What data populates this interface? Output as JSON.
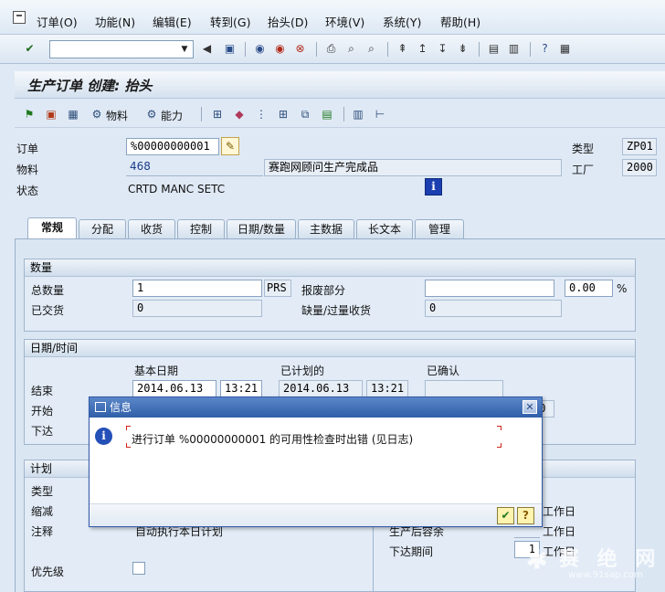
{
  "menubar": {
    "items": [
      "订单(O)",
      "功能(N)",
      "编辑(E)",
      "转到(G)",
      "抬头(D)",
      "环境(V)",
      "系统(Y)",
      "帮助(H)"
    ]
  },
  "toolbar": {
    "command_value": ""
  },
  "screen": {
    "title": "生产订单 创建: 抬头"
  },
  "app_toolbar": {
    "material_label": "物料",
    "capacity_label": "能力"
  },
  "header": {
    "order_label": "订单",
    "order_value": "%00000000001",
    "material_label": "物料",
    "material_value": "468",
    "material_desc": "赛跑网顾问生产完成品",
    "status_label": "状态",
    "status_value": "CRTD MANC SETC",
    "type_label": "类型",
    "type_value": "ZP01",
    "plant_label": "工厂",
    "plant_value": "2000"
  },
  "tabs": [
    "常规",
    "分配",
    "收货",
    "控制",
    "日期/数量",
    "主数据",
    "长文本",
    "管理"
  ],
  "quantities": {
    "title": "数量",
    "total_label": "总数量",
    "total_value": "1",
    "unit": "PRS",
    "scrap_label": "报废部分",
    "scrap_value": "",
    "scrap_pct": "0.00",
    "pct_sign": "%",
    "delivered_label": "已交货",
    "delivered_value": "0",
    "short_label": "缺量/过量收货",
    "short_value": "0"
  },
  "dates": {
    "title": "日期/时间",
    "basic_label": "基本日期",
    "scheduled_label": "已计划的",
    "confirmed_label": "已确认",
    "end_label": "结束",
    "end_basic_date": "2014.06.13",
    "end_basic_time": "13:21",
    "end_sched_date": "2014.06.13",
    "end_sched_time": "13:21",
    "start_label": "开始",
    "start_partial": "00",
    "release_label": "下达"
  },
  "planning": {
    "title": "计划",
    "type_label": "类型",
    "reduction_label": "缩减",
    "note_label": "注释",
    "note_value": "自动执行本日计划",
    "priority_label": "优先级",
    "workday1": "工作日",
    "workday2": "工作日",
    "workday3": "工作日",
    "post_prod_label": "生产后容余",
    "release_period_label": "下达期间",
    "release_period_value": "1"
  },
  "dialog": {
    "title": "信息",
    "message": "进行订单 %00000000001 的可用性检查时出错 (见日志)"
  },
  "watermark": {
    "main": "赛 绝 网",
    "url": "www.91sap.com"
  }
}
